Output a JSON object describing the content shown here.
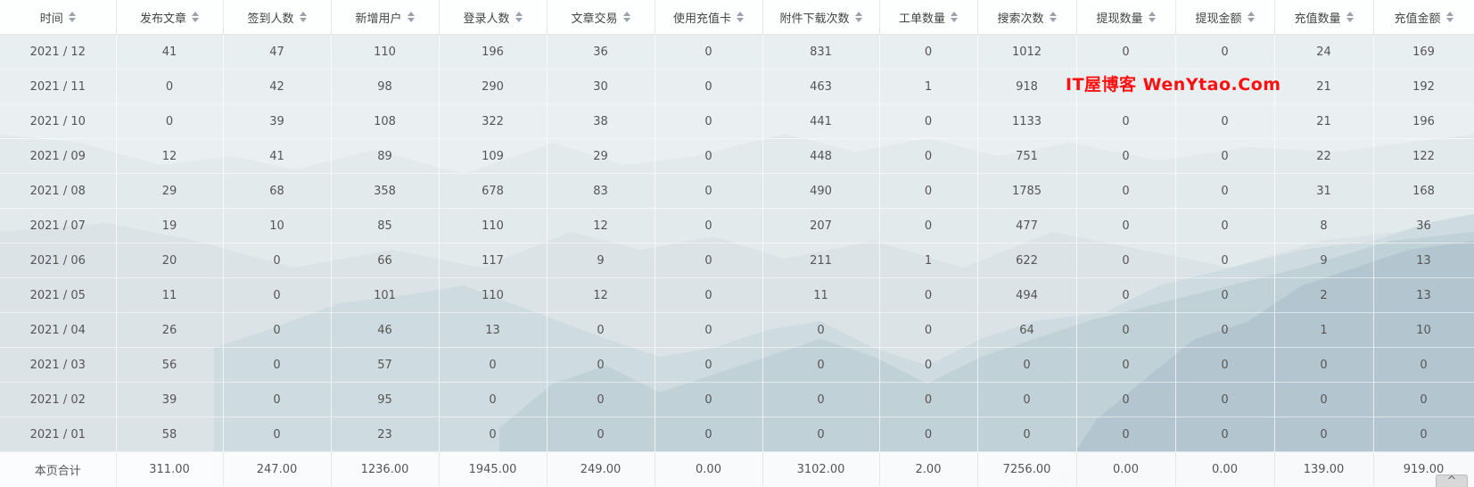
{
  "table": {
    "headers": [
      "时间",
      "发布文章",
      "签到人数",
      "新增用户",
      "登录人数",
      "文章交易",
      "使用充值卡",
      "附件下载次数",
      "工单数量",
      "搜索次数",
      "提现数量",
      "提现金额",
      "充值数量",
      "充值金额"
    ],
    "rows": [
      [
        "2021 / 12",
        "41",
        "47",
        "110",
        "196",
        "36",
        "0",
        "831",
        "0",
        "1012",
        "0",
        "0",
        "24",
        "169"
      ],
      [
        "2021 / 11",
        "0",
        "42",
        "98",
        "290",
        "30",
        "0",
        "463",
        "1",
        "918",
        "",
        "",
        "21",
        "192"
      ],
      [
        "2021 / 10",
        "0",
        "39",
        "108",
        "322",
        "38",
        "0",
        "441",
        "0",
        "1133",
        "0",
        "0",
        "21",
        "196"
      ],
      [
        "2021 / 09",
        "12",
        "41",
        "89",
        "109",
        "29",
        "0",
        "448",
        "0",
        "751",
        "0",
        "0",
        "22",
        "122"
      ],
      [
        "2021 / 08",
        "29",
        "68",
        "358",
        "678",
        "83",
        "0",
        "490",
        "0",
        "1785",
        "0",
        "0",
        "31",
        "168"
      ],
      [
        "2021 / 07",
        "19",
        "10",
        "85",
        "110",
        "12",
        "0",
        "207",
        "0",
        "477",
        "0",
        "0",
        "8",
        "36"
      ],
      [
        "2021 / 06",
        "20",
        "0",
        "66",
        "117",
        "9",
        "0",
        "211",
        "1",
        "622",
        "0",
        "0",
        "9",
        "13"
      ],
      [
        "2021 / 05",
        "11",
        "0",
        "101",
        "110",
        "12",
        "0",
        "11",
        "0",
        "494",
        "0",
        "0",
        "2",
        "13"
      ],
      [
        "2021 / 04",
        "26",
        "0",
        "46",
        "13",
        "0",
        "0",
        "0",
        "0",
        "64",
        "0",
        "0",
        "1",
        "10"
      ],
      [
        "2021 / 03",
        "56",
        "0",
        "57",
        "0",
        "0",
        "0",
        "0",
        "0",
        "0",
        "0",
        "0",
        "0",
        "0"
      ],
      [
        "2021 / 02",
        "39",
        "0",
        "95",
        "0",
        "0",
        "0",
        "0",
        "0",
        "0",
        "0",
        "0",
        "0",
        "0"
      ],
      [
        "2021 / 01",
        "58",
        "0",
        "23",
        "0",
        "0",
        "0",
        "0",
        "0",
        "0",
        "0",
        "0",
        "0",
        "0"
      ]
    ],
    "total": [
      "本页合计",
      "311.00",
      "247.00",
      "1236.00",
      "1945.00",
      "249.00",
      "0.00",
      "3102.00",
      "2.00",
      "7256.00",
      "0.00",
      "0.00",
      "139.00",
      "919.00"
    ]
  },
  "watermark": "IT屋博客  WenYtao.Com",
  "scroll_top_icon": "^"
}
